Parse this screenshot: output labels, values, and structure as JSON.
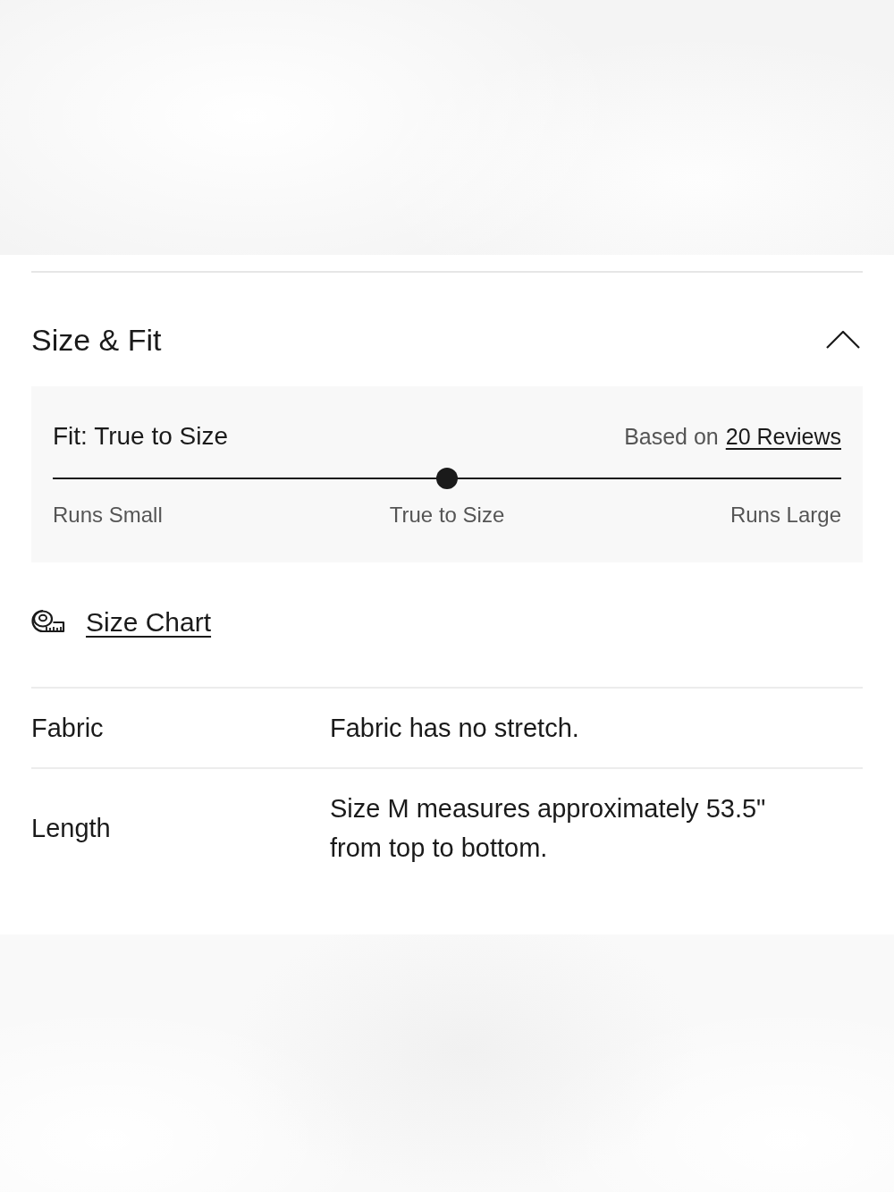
{
  "section": {
    "title": "Size & Fit",
    "expanded": true
  },
  "fit": {
    "title": "Fit: True to Size",
    "based_on": "Based on",
    "reviews_link": "20 Reviews",
    "level": 0.5,
    "scale_labels": [
      "Runs Small",
      "True to Size",
      "Runs Large"
    ]
  },
  "size_chart_link": "Size Chart",
  "details": [
    {
      "label": "Fabric",
      "value": "Fabric has no stretch."
    },
    {
      "label": "Length",
      "value": "Size M measures approximately 53.5\" from top to bottom."
    }
  ]
}
